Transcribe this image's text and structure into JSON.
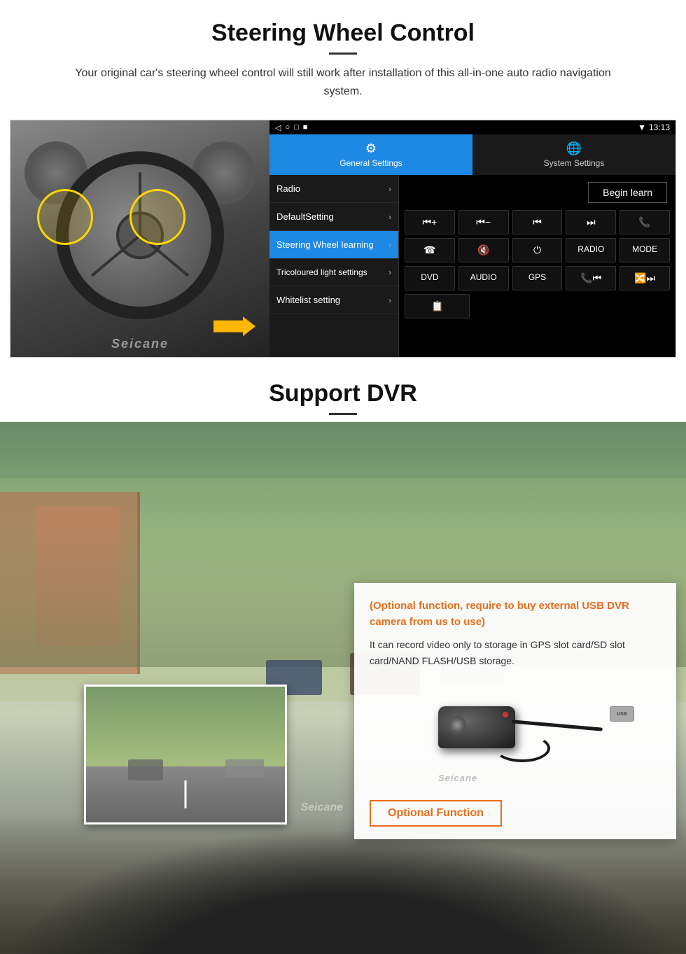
{
  "page": {
    "steering_section": {
      "title": "Steering Wheel Control",
      "description": "Your original car's steering wheel control will still work after installation of this all-in-one auto radio navigation system.",
      "android_ui": {
        "status_bar": {
          "nav_icons": [
            "◁",
            "○",
            "□",
            "■"
          ],
          "time": "13:13",
          "signal": "▼"
        },
        "tabs": [
          {
            "label": "General Settings",
            "icon": "⚙",
            "active": true
          },
          {
            "label": "System Settings",
            "icon": "🌐",
            "active": false
          }
        ],
        "menu_items": [
          {
            "label": "Radio",
            "active": false
          },
          {
            "label": "DefaultSetting",
            "active": false
          },
          {
            "label": "Steering Wheel learning",
            "active": true
          },
          {
            "label": "Tricoloured light settings",
            "active": false
          },
          {
            "label": "Whitelist setting",
            "active": false
          }
        ],
        "begin_learn_label": "Begin learn",
        "control_buttons": [
          [
            "⏮+",
            "⏮−",
            "⏮",
            "⏭",
            "📞"
          ],
          [
            "☎",
            "🔇",
            "⏻",
            "RADIO",
            "MODE"
          ],
          [
            "DVD",
            "AUDIO",
            "GPS",
            "📞⏮",
            "🔀⏭"
          ],
          [
            "📋"
          ]
        ]
      }
    },
    "dvr_section": {
      "title": "Support DVR",
      "optional_text": "(Optional function, require to buy external USB DVR camera from us to use)",
      "description": "It can record video only to storage in GPS slot card/SD slot card/NAND FLASH/USB storage.",
      "optional_function_label": "Optional Function"
    }
  }
}
